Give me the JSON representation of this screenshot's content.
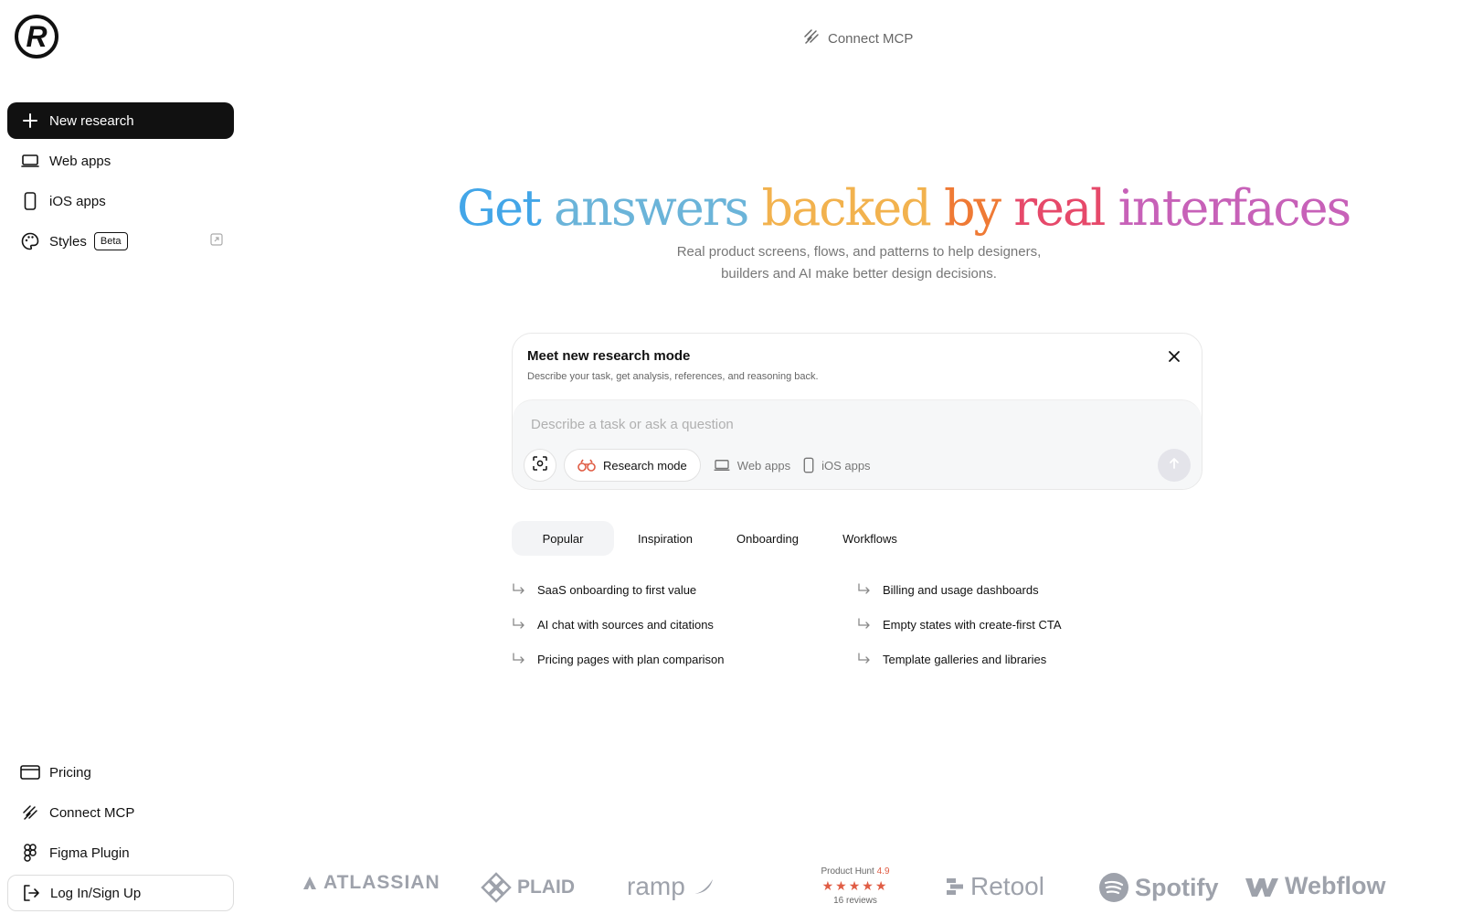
{
  "brand": {
    "logo_symbol": "R"
  },
  "header": {
    "connect_label": "Connect MCP"
  },
  "sidebar": {
    "items": [
      {
        "label": "New research"
      },
      {
        "label": "Web apps"
      },
      {
        "label": "iOS apps"
      },
      {
        "label": "Styles",
        "badge": "Beta"
      }
    ],
    "bottom": [
      {
        "label": "Pricing"
      },
      {
        "label": "Connect MCP"
      },
      {
        "label": "Figma Plugin"
      },
      {
        "label": "Log In/Sign Up"
      }
    ]
  },
  "hero": {
    "title_words": [
      "Get",
      "answers",
      "backed",
      "by",
      "real",
      "interfaces"
    ],
    "subtitle_line1": "Real product screens, flows, and patterns to help designers,",
    "subtitle_line2": "builders and AI make better design decisions."
  },
  "research_card": {
    "title": "Meet new research mode",
    "description": "Describe your task, get analysis, references, and reasoning back.",
    "placeholder": "Describe a task or ask a question",
    "mode_label": "Research mode",
    "web_label": "Web apps",
    "ios_label": "iOS apps"
  },
  "tabs": [
    "Popular",
    "Inspiration",
    "Onboarding",
    "Workflows"
  ],
  "suggestions_left": [
    "SaaS onboarding to first value",
    "AI chat with sources and citations",
    "Pricing pages with plan comparison"
  ],
  "suggestions_right": [
    "Billing and usage dashboards",
    "Empty states with create-first CTA",
    "Template galleries and libraries"
  ],
  "logos": {
    "atlassian": "ATLASSIAN",
    "plaid": "PLAID",
    "ramp": "ramp",
    "producthunt_label": "Product Hunt",
    "producthunt_rating": "4.9",
    "producthunt_stars": "★★★★★",
    "producthunt_reviews": "16 reviews",
    "retool": "Retool",
    "spotify": "Spotify",
    "webflow": "Webflow"
  },
  "colors": {
    "primary_button": "#111111",
    "accent_red": "#e05d45",
    "muted_logo": "#9ea2ab"
  }
}
